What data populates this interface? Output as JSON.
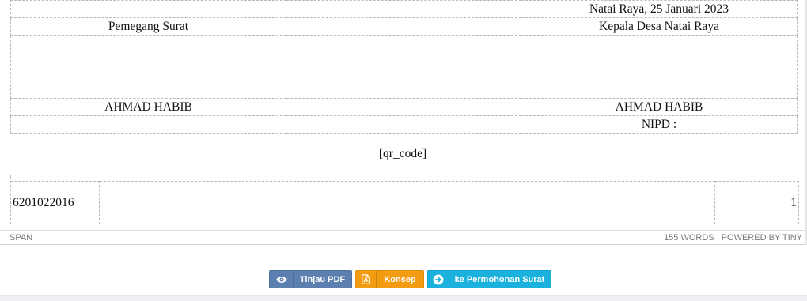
{
  "signature": {
    "date_line": "Natai Raya, 25 Januari 2023",
    "left_role": "Pemegang Surat",
    "right_role": "Kepala Desa Natai Raya",
    "left_name": "AHMAD HABIB",
    "right_name": "AHMAD HABIB",
    "nipd": "NIPD :"
  },
  "qr_placeholder": "[qr_code]",
  "code_row": {
    "code": "6201022016",
    "middle": "",
    "page": "1"
  },
  "statusbar": {
    "path": "SPAN",
    "word_count": "155 WORDS",
    "powered_by": "POWERED BY TINY"
  },
  "buttons": {
    "preview_pdf": "Tinjau PDF",
    "draft": "Konsep",
    "to_requests": "ke Permohonan Surat"
  },
  "icons": {
    "preview_pdf": "eye-icon",
    "draft": "file-pdf-icon",
    "to_requests": "arrow-circle-right-icon"
  },
  "colors": {
    "preview_pdf_button": "#5b7fae",
    "draft_button": "#f39c12",
    "to_requests_button": "#1ab1dd"
  }
}
